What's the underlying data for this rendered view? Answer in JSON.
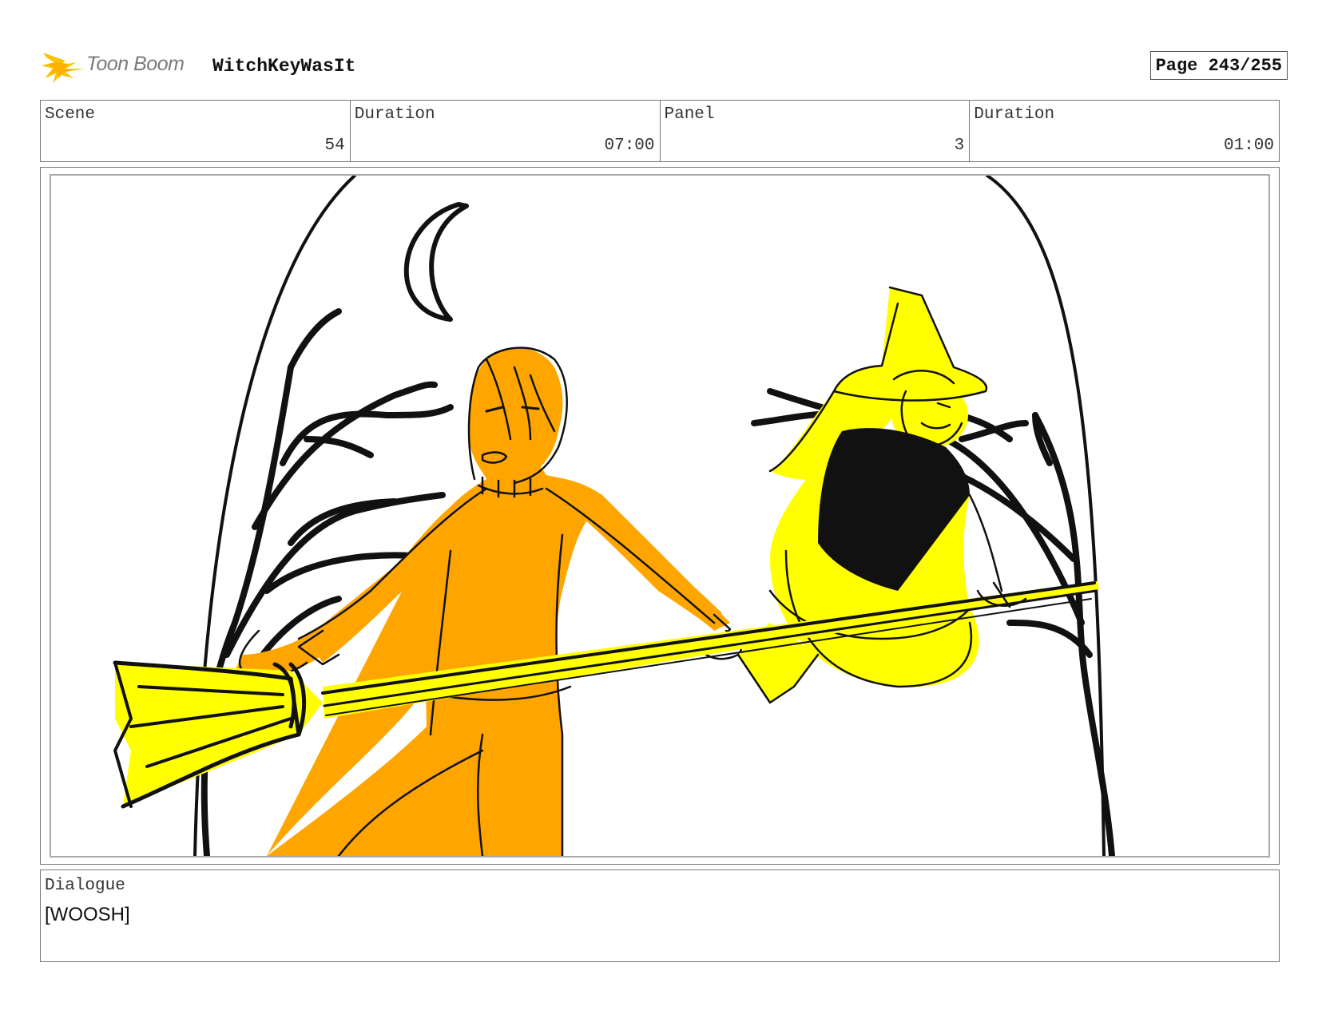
{
  "header": {
    "logo_text": "Toon Boom",
    "project_title": "WitchKeyWasIt",
    "page_label": "Page 243/255"
  },
  "info": {
    "scene_label": "Scene",
    "scene_value": "54",
    "scene_duration_label": "Duration",
    "scene_duration_value": "07:00",
    "panel_label": "Panel",
    "panel_value": "3",
    "panel_duration_label": "Duration",
    "panel_duration_value": "01:00"
  },
  "dialogue": {
    "label": "Dialogue",
    "text": "[WOOSH]"
  },
  "colors": {
    "logo_yellow": "#f6c500",
    "boy_orange": "#ffa500",
    "witch_yellow": "#ffff00",
    "line_black": "#111111"
  }
}
